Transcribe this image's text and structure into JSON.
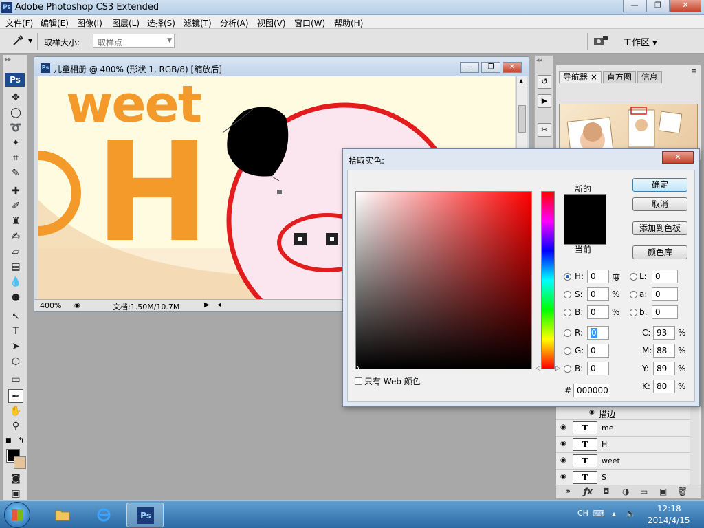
{
  "app": {
    "logo": "Ps",
    "title": "Adobe Photoshop CS3 Extended",
    "window_buttons": [
      "—",
      "❐",
      "✕"
    ]
  },
  "menu": [
    "文件(F)",
    "编辑(E)",
    "图像(I)",
    "图层(L)",
    "选择(S)",
    "滤镜(T)",
    "分析(A)",
    "视图(V)",
    "窗口(W)",
    "帮助(H)"
  ],
  "options_bar": {
    "sample_size_label": "取样大小:",
    "sample_size_value": "取样点",
    "workspace_label": "工作区 ▾"
  },
  "toolbox": {
    "badge": "Ps",
    "tools": [
      "move-icon",
      "marquee-icon",
      "lasso-icon",
      "magic-wand-icon",
      "crop-icon",
      "slice-icon",
      "healing-icon",
      "brush-icon",
      "clone-stamp-icon",
      "history-brush-icon",
      "eraser-icon",
      "gradient-icon",
      "blur-icon",
      "dodge-icon",
      "path-select-icon",
      "type-icon",
      "direct-select-icon",
      "shape-icon",
      "notes-icon",
      "eyedropper-icon",
      "hand-icon",
      "zoom-icon"
    ],
    "foreground_color": "#000000",
    "background_color": "#e6c49b"
  },
  "document": {
    "title": "儿童相册 @ 400% (形状 1, RGB/8) [缩放后]",
    "zoom": "400%",
    "info": "文档:1.50M/10.7M",
    "canvas_texts": [
      "weet",
      "H"
    ]
  },
  "navigator": {
    "tabs": [
      "导航器 ×",
      "直方图",
      "信息"
    ],
    "active_tab": 0
  },
  "layers": {
    "effect_label": "描边",
    "rows": [
      {
        "name": "me"
      },
      {
        "name": "H"
      },
      {
        "name": "weet"
      },
      {
        "name": "S"
      }
    ]
  },
  "color_picker": {
    "title": "拾取实色:",
    "label_new": "新的",
    "label_current": "当前",
    "new_color": "#000000",
    "buttons": {
      "ok": "确定",
      "cancel": "取消",
      "add_to_swatches": "添加到色板",
      "color_libraries": "颜色库"
    },
    "hsb": {
      "h_label": "H:",
      "h_value": "0",
      "h_unit": "度",
      "s_label": "S:",
      "s_value": "0",
      "s_unit": "%",
      "b_label": "B:",
      "b_value": "0",
      "b_unit": "%"
    },
    "lab": {
      "l_label": "L:",
      "l_value": "0",
      "a_label": "a:",
      "a_value": "0",
      "b_label": "b:",
      "b_value": "0"
    },
    "rgb": {
      "r_label": "R:",
      "r_value": "0",
      "g_label": "G:",
      "g_value": "0",
      "b_label": "B:",
      "b_value": "0"
    },
    "cmyk": {
      "c_label": "C:",
      "c_value": "93",
      "m_label": "M:",
      "m_value": "88",
      "y_label": "Y:",
      "y_value": "89",
      "k_label": "K:",
      "k_value": "80",
      "unit": "%"
    },
    "web_only_label": "只有 Web 颜色",
    "hex_label": "#",
    "hex_value": "000000"
  },
  "taskbar": {
    "lang": "CH",
    "time": "12:18",
    "date": "2014/4/15",
    "ps_label": "Ps"
  }
}
